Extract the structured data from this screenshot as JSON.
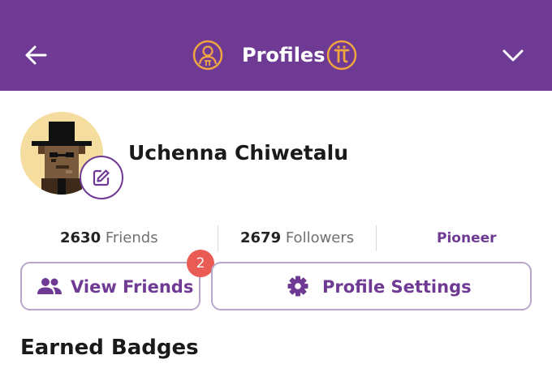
{
  "colors": {
    "header_bg": "#6f3a93",
    "accent": "#6f3a93",
    "gold": "#f0a640",
    "badge_red": "#ea5b55",
    "avatar_bg": "#f5dda0"
  },
  "header": {
    "title": "Profiles",
    "back_icon": "arrow-left-icon",
    "profile_icon": "user-circle-icon",
    "pi_icon": "pi-coin-icon",
    "menu_icon": "chevron-down-icon"
  },
  "profile": {
    "name": "Uchenna Chiwetalu",
    "avatar_icon": "pixel-art-avatar",
    "edit_icon": "edit-icon"
  },
  "stats": {
    "friends": {
      "count": "2630",
      "label": "Friends"
    },
    "followers": {
      "count": "2679",
      "label": "Followers"
    },
    "role": "Pioneer"
  },
  "actions": {
    "view_friends": {
      "label": "View Friends",
      "icon": "people-icon",
      "badge": "2"
    },
    "profile_settings": {
      "label": "Profile Settings",
      "icon": "gear-icon"
    }
  },
  "section": {
    "title": "Earned Badges"
  }
}
